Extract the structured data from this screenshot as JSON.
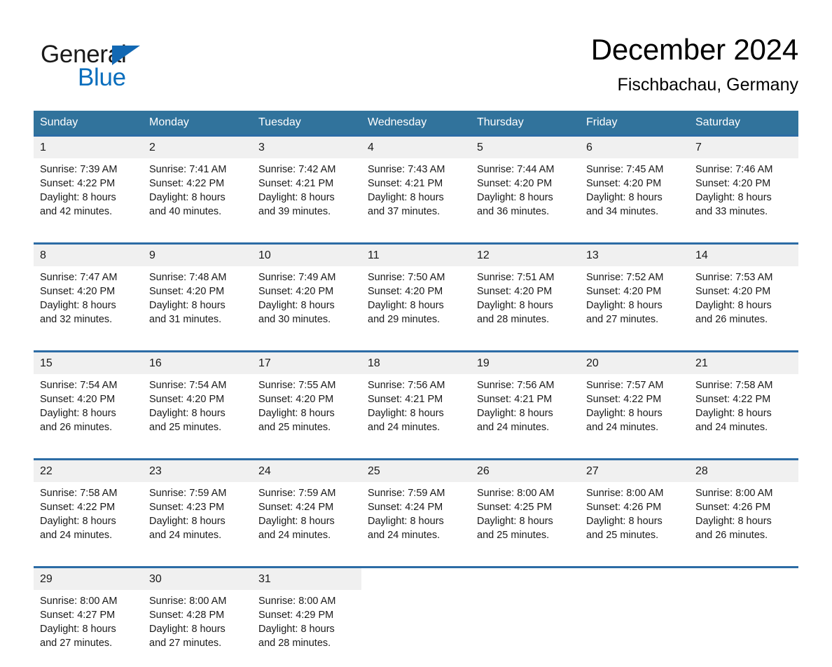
{
  "brand": {
    "name_part1": "General",
    "name_part2": "Blue",
    "triangle_color": "#1268b3",
    "blue_color": "#0a6ebd"
  },
  "header": {
    "month_title": "December 2024",
    "location": "Fischbachau, Germany"
  },
  "theme": {
    "header_bg": "#31739c",
    "daynum_bg": "#f0f0f0",
    "separator": "#2c6ca5",
    "page_bg": "#ffffff",
    "text": "#1a1a1a"
  },
  "calendar": {
    "weekday_headers": [
      "Sunday",
      "Monday",
      "Tuesday",
      "Wednesday",
      "Thursday",
      "Friday",
      "Saturday"
    ],
    "weeks": [
      {
        "days": [
          {
            "num": "1",
            "sunrise": "Sunrise: 7:39 AM",
            "sunset": "Sunset: 4:22 PM",
            "daylight1": "Daylight: 8 hours",
            "daylight2": "and 42 minutes."
          },
          {
            "num": "2",
            "sunrise": "Sunrise: 7:41 AM",
            "sunset": "Sunset: 4:22 PM",
            "daylight1": "Daylight: 8 hours",
            "daylight2": "and 40 minutes."
          },
          {
            "num": "3",
            "sunrise": "Sunrise: 7:42 AM",
            "sunset": "Sunset: 4:21 PM",
            "daylight1": "Daylight: 8 hours",
            "daylight2": "and 39 minutes."
          },
          {
            "num": "4",
            "sunrise": "Sunrise: 7:43 AM",
            "sunset": "Sunset: 4:21 PM",
            "daylight1": "Daylight: 8 hours",
            "daylight2": "and 37 minutes."
          },
          {
            "num": "5",
            "sunrise": "Sunrise: 7:44 AM",
            "sunset": "Sunset: 4:20 PM",
            "daylight1": "Daylight: 8 hours",
            "daylight2": "and 36 minutes."
          },
          {
            "num": "6",
            "sunrise": "Sunrise: 7:45 AM",
            "sunset": "Sunset: 4:20 PM",
            "daylight1": "Daylight: 8 hours",
            "daylight2": "and 34 minutes."
          },
          {
            "num": "7",
            "sunrise": "Sunrise: 7:46 AM",
            "sunset": "Sunset: 4:20 PM",
            "daylight1": "Daylight: 8 hours",
            "daylight2": "and 33 minutes."
          }
        ]
      },
      {
        "days": [
          {
            "num": "8",
            "sunrise": "Sunrise: 7:47 AM",
            "sunset": "Sunset: 4:20 PM",
            "daylight1": "Daylight: 8 hours",
            "daylight2": "and 32 minutes."
          },
          {
            "num": "9",
            "sunrise": "Sunrise: 7:48 AM",
            "sunset": "Sunset: 4:20 PM",
            "daylight1": "Daylight: 8 hours",
            "daylight2": "and 31 minutes."
          },
          {
            "num": "10",
            "sunrise": "Sunrise: 7:49 AM",
            "sunset": "Sunset: 4:20 PM",
            "daylight1": "Daylight: 8 hours",
            "daylight2": "and 30 minutes."
          },
          {
            "num": "11",
            "sunrise": "Sunrise: 7:50 AM",
            "sunset": "Sunset: 4:20 PM",
            "daylight1": "Daylight: 8 hours",
            "daylight2": "and 29 minutes."
          },
          {
            "num": "12",
            "sunrise": "Sunrise: 7:51 AM",
            "sunset": "Sunset: 4:20 PM",
            "daylight1": "Daylight: 8 hours",
            "daylight2": "and 28 minutes."
          },
          {
            "num": "13",
            "sunrise": "Sunrise: 7:52 AM",
            "sunset": "Sunset: 4:20 PM",
            "daylight1": "Daylight: 8 hours",
            "daylight2": "and 27 minutes."
          },
          {
            "num": "14",
            "sunrise": "Sunrise: 7:53 AM",
            "sunset": "Sunset: 4:20 PM",
            "daylight1": "Daylight: 8 hours",
            "daylight2": "and 26 minutes."
          }
        ]
      },
      {
        "days": [
          {
            "num": "15",
            "sunrise": "Sunrise: 7:54 AM",
            "sunset": "Sunset: 4:20 PM",
            "daylight1": "Daylight: 8 hours",
            "daylight2": "and 26 minutes."
          },
          {
            "num": "16",
            "sunrise": "Sunrise: 7:54 AM",
            "sunset": "Sunset: 4:20 PM",
            "daylight1": "Daylight: 8 hours",
            "daylight2": "and 25 minutes."
          },
          {
            "num": "17",
            "sunrise": "Sunrise: 7:55 AM",
            "sunset": "Sunset: 4:20 PM",
            "daylight1": "Daylight: 8 hours",
            "daylight2": "and 25 minutes."
          },
          {
            "num": "18",
            "sunrise": "Sunrise: 7:56 AM",
            "sunset": "Sunset: 4:21 PM",
            "daylight1": "Daylight: 8 hours",
            "daylight2": "and 24 minutes."
          },
          {
            "num": "19",
            "sunrise": "Sunrise: 7:56 AM",
            "sunset": "Sunset: 4:21 PM",
            "daylight1": "Daylight: 8 hours",
            "daylight2": "and 24 minutes."
          },
          {
            "num": "20",
            "sunrise": "Sunrise: 7:57 AM",
            "sunset": "Sunset: 4:22 PM",
            "daylight1": "Daylight: 8 hours",
            "daylight2": "and 24 minutes."
          },
          {
            "num": "21",
            "sunrise": "Sunrise: 7:58 AM",
            "sunset": "Sunset: 4:22 PM",
            "daylight1": "Daylight: 8 hours",
            "daylight2": "and 24 minutes."
          }
        ]
      },
      {
        "days": [
          {
            "num": "22",
            "sunrise": "Sunrise: 7:58 AM",
            "sunset": "Sunset: 4:22 PM",
            "daylight1": "Daylight: 8 hours",
            "daylight2": "and 24 minutes."
          },
          {
            "num": "23",
            "sunrise": "Sunrise: 7:59 AM",
            "sunset": "Sunset: 4:23 PM",
            "daylight1": "Daylight: 8 hours",
            "daylight2": "and 24 minutes."
          },
          {
            "num": "24",
            "sunrise": "Sunrise: 7:59 AM",
            "sunset": "Sunset: 4:24 PM",
            "daylight1": "Daylight: 8 hours",
            "daylight2": "and 24 minutes."
          },
          {
            "num": "25",
            "sunrise": "Sunrise: 7:59 AM",
            "sunset": "Sunset: 4:24 PM",
            "daylight1": "Daylight: 8 hours",
            "daylight2": "and 24 minutes."
          },
          {
            "num": "26",
            "sunrise": "Sunrise: 8:00 AM",
            "sunset": "Sunset: 4:25 PM",
            "daylight1": "Daylight: 8 hours",
            "daylight2": "and 25 minutes."
          },
          {
            "num": "27",
            "sunrise": "Sunrise: 8:00 AM",
            "sunset": "Sunset: 4:26 PM",
            "daylight1": "Daylight: 8 hours",
            "daylight2": "and 25 minutes."
          },
          {
            "num": "28",
            "sunrise": "Sunrise: 8:00 AM",
            "sunset": "Sunset: 4:26 PM",
            "daylight1": "Daylight: 8 hours",
            "daylight2": "and 26 minutes."
          }
        ]
      },
      {
        "days": [
          {
            "num": "29",
            "sunrise": "Sunrise: 8:00 AM",
            "sunset": "Sunset: 4:27 PM",
            "daylight1": "Daylight: 8 hours",
            "daylight2": "and 27 minutes."
          },
          {
            "num": "30",
            "sunrise": "Sunrise: 8:00 AM",
            "sunset": "Sunset: 4:28 PM",
            "daylight1": "Daylight: 8 hours",
            "daylight2": "and 27 minutes."
          },
          {
            "num": "31",
            "sunrise": "Sunrise: 8:00 AM",
            "sunset": "Sunset: 4:29 PM",
            "daylight1": "Daylight: 8 hours",
            "daylight2": "and 28 minutes."
          },
          {
            "num": "",
            "sunrise": "",
            "sunset": "",
            "daylight1": "",
            "daylight2": ""
          },
          {
            "num": "",
            "sunrise": "",
            "sunset": "",
            "daylight1": "",
            "daylight2": ""
          },
          {
            "num": "",
            "sunrise": "",
            "sunset": "",
            "daylight1": "",
            "daylight2": ""
          },
          {
            "num": "",
            "sunrise": "",
            "sunset": "",
            "daylight1": "",
            "daylight2": ""
          }
        ]
      }
    ]
  }
}
